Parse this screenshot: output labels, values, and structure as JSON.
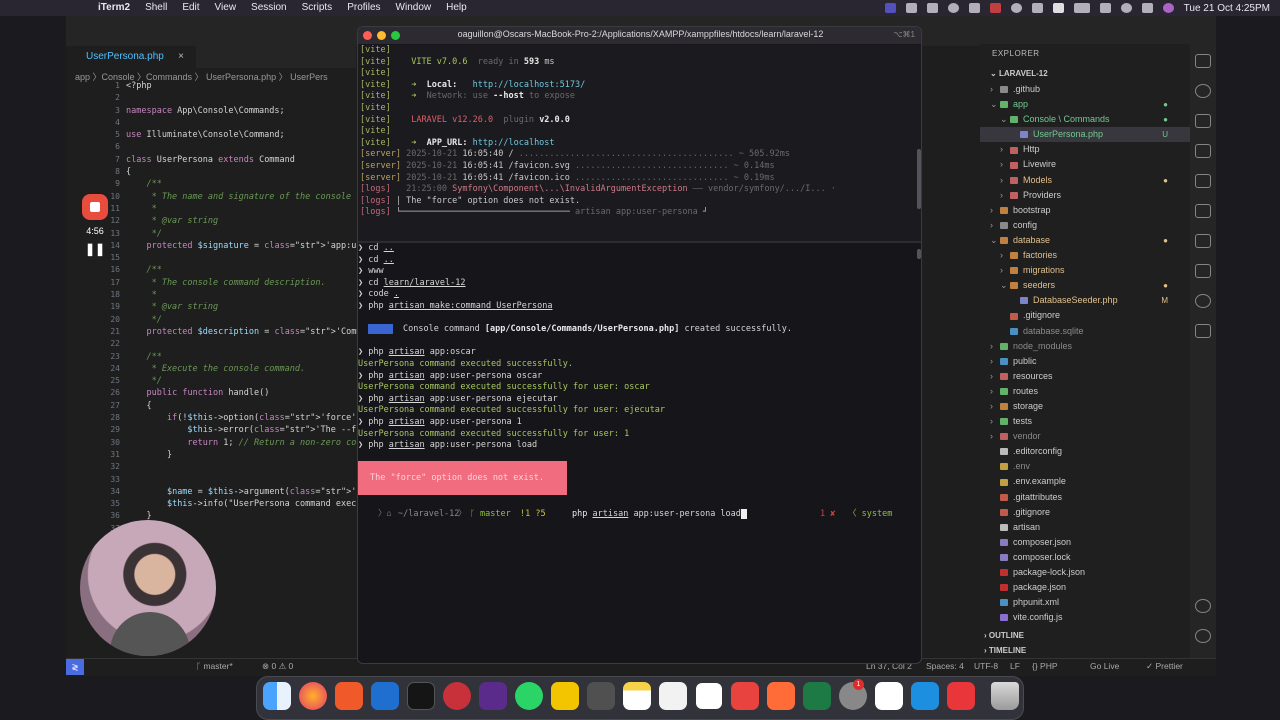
{
  "menubar": {
    "app_name": "iTerm2",
    "items": [
      "Shell",
      "Edit",
      "View",
      "Session",
      "Scripts",
      "Profiles",
      "Window",
      "Help"
    ],
    "date_time": "Tue 21 Oct  4:25PM"
  },
  "editor": {
    "tab_label": "UserPersona.php",
    "tab_close": "×",
    "breadcrumb": "app 〉Console 〉Commands 〉 UserPersona.php 〉 UserPers",
    "line_numbers": [
      "1",
      "2",
      "3",
      "4",
      "5",
      "6",
      "7",
      "8",
      "9",
      "10",
      "11",
      "12",
      "13",
      "14",
      "15",
      "16",
      "17",
      "18",
      "19",
      "20",
      "21",
      "22",
      "23",
      "24",
      "25",
      "26",
      "27",
      "28",
      "29",
      "30",
      "31",
      "32",
      "33",
      "34",
      "35",
      "36",
      "37"
    ],
    "code_lines": [
      "<?php",
      "",
      "namespace App\\Console\\Commands;",
      "",
      "use Illuminate\\Console\\Command;",
      "",
      "class UserPersona extends Command",
      "{",
      "    /**",
      "     * The name and signature of the console comm",
      "     *",
      "     * @var string",
      "     */",
      "    protected $signature = 'app:user-persona {name",
      "",
      "    /**",
      "     * The console command description.",
      "     *",
      "     * @var string",
      "     */",
      "    protected $description = 'Command description'",
      "",
      "    /**",
      "     * Execute the console command.",
      "     */",
      "    public function handle()",
      "    {",
      "        if(!$this->option('force')) {",
      "            $this->error('The --force option is re",
      "            return 1; // Return a non-zero code to",
      "        }",
      "",
      "",
      "        $name = $this->argument('name');",
      "        $this->info(\"UserPersona command executed",
      "    }",
      "}"
    ]
  },
  "recorder": {
    "time": "4:56",
    "pause_symbol": "❚❚"
  },
  "iterm": {
    "title": "oaguillon@Oscars-MacBook-Pro-2:/Applications/XAMPP/xamppfiles/htdocs/learn/laravel-12",
    "shortcut": "⌥⌘1",
    "vite": {
      "tag": "[vite]",
      "version": "VITE v7.0.6",
      "ready": "ready in",
      "ready_ms": "593",
      "ms": "ms",
      "local_label": "Local:",
      "local_url": "http://localhost:5173/",
      "network_label": "Network:",
      "network_text": "use",
      "network_flag": "--host",
      "network_tail": "to expose",
      "laravel_version": "LARAVEL v12.26.0",
      "plugin_label": "plugin",
      "plugin_version": "v2.0.0",
      "app_url_label": "APP_URL:",
      "app_url": "http://localhost"
    },
    "server_lines": [
      {
        "tag": "[server]",
        "date": "2025-10-21",
        "time": "16:05:40",
        "path": "/",
        "dots": "..........................................",
        "dur": "~ 505.92ms"
      },
      {
        "tag": "[server]",
        "date": "2025-10-21",
        "time": "16:05:41",
        "path": "/favicon.svg",
        "dots": "..............................",
        "dur": "~ 0.14ms"
      },
      {
        "tag": "[server]",
        "date": "2025-10-21",
        "time": "16:05:41",
        "path": "/favicon.ico",
        "dots": "..............................",
        "dur": "~ 0.19ms"
      }
    ],
    "logs": {
      "tag": "[logs]",
      "time": "21:25:00",
      "exception": "Symfony\\Component\\...\\InvalidArgumentException",
      "src": "—— vendor/symfony/.../I... ·",
      "message": "The \"force\" option does not exist.",
      "footer": "artisan app:user-persona"
    },
    "history": [
      {
        "sym": "❯",
        "cmd": "cd",
        "arg": ".."
      },
      {
        "sym": "❯",
        "cmd": "cd",
        "arg": ".."
      },
      {
        "sym": "❯",
        "cmd": "www",
        "arg": ""
      },
      {
        "sym": "❯",
        "cmd": "cd",
        "arg": "learn/laravel-12"
      },
      {
        "sym": "❯",
        "cmd": "code",
        "arg": "."
      },
      {
        "sym": "❯",
        "cmd": "php",
        "arg": "artisan make:command UserPersona"
      }
    ],
    "info_tag": "INFO",
    "info_text": "Console command",
    "info_path": "[app/Console/Commands/UserPersona.php]",
    "info_tail": "created successfully.",
    "runs": [
      {
        "cmd": "php",
        "rest": "app:oscar",
        "art": "artisan"
      },
      {
        "out": "UserPersona command executed successfully."
      },
      {
        "cmd": "php",
        "rest": "app:user-persona oscar",
        "art": "artisan"
      },
      {
        "out": "UserPersona command executed successfully for user: oscar"
      },
      {
        "cmd": "php",
        "rest": "app:user-persona ejecutar",
        "art": "artisan"
      },
      {
        "out": "UserPersona command executed successfully for user: ejecutar"
      },
      {
        "cmd": "php",
        "rest": "app:user-persona 1",
        "art": "artisan"
      },
      {
        "out": "UserPersona command executed successfully for user: 1"
      },
      {
        "cmd": "php",
        "rest": "app:user-persona load",
        "art": "artisan"
      }
    ],
    "error_box": "The \"force\" option does not exist.",
    "prompt": {
      "apple": "",
      "folder": "~/laravel-12",
      "branch_icon": "ᚴ",
      "branch": "master",
      "git_status": "!1 ?5",
      "command": "php",
      "artisan": "artisan",
      "args": "app:user-persona load",
      "exit": "1 ✘",
      "right": "〈 system"
    }
  },
  "explorer": {
    "title": "EXPLORER",
    "root": "LARAVEL-12",
    "items": [
      {
        "label": ".github",
        "depth": 1,
        "kind": "folder",
        "color": "#8a8a8a",
        "status": ""
      },
      {
        "label": "app",
        "depth": 1,
        "kind": "folder",
        "color": "#63b26a",
        "status": "●",
        "open": true,
        "text_color": "#73c991"
      },
      {
        "label": "Console \\ Commands",
        "depth": 2,
        "kind": "folder",
        "color": "#63b26a",
        "status": "●",
        "open": true,
        "text_color": "#73c991"
      },
      {
        "label": "UserPersona.php",
        "depth": 3,
        "kind": "php",
        "color": "#7a86c7",
        "status": "U",
        "text_color": "#73c991",
        "selected": true
      },
      {
        "label": "Http",
        "depth": 2,
        "kind": "folder",
        "color": "#c06060",
        "status": ""
      },
      {
        "label": "Livewire",
        "depth": 2,
        "kind": "folder",
        "color": "#c06060",
        "status": ""
      },
      {
        "label": "Models",
        "depth": 2,
        "kind": "folder",
        "color": "#c06060",
        "status": "●",
        "text_color": "#e2c08d"
      },
      {
        "label": "Providers",
        "depth": 2,
        "kind": "folder",
        "color": "#c06060",
        "status": ""
      },
      {
        "label": "bootstrap",
        "depth": 1,
        "kind": "folder",
        "color": "#c08040",
        "status": ""
      },
      {
        "label": "config",
        "depth": 1,
        "kind": "folder",
        "color": "#8a8a8a",
        "status": ""
      },
      {
        "label": "database",
        "depth": 1,
        "kind": "folder",
        "color": "#c08040",
        "status": "●",
        "open": true,
        "text_color": "#e2c08d"
      },
      {
        "label": "factories",
        "depth": 2,
        "kind": "folder",
        "color": "#c08040",
        "status": "",
        "text_color": "#e2c08d"
      },
      {
        "label": "migrations",
        "depth": 2,
        "kind": "folder",
        "color": "#c08040",
        "status": "",
        "text_color": "#e2c08d"
      },
      {
        "label": "seeders",
        "depth": 2,
        "kind": "folder",
        "color": "#c08040",
        "status": "●",
        "open": true,
        "text_color": "#e2c08d"
      },
      {
        "label": "DatabaseSeeder.php",
        "depth": 3,
        "kind": "php",
        "color": "#7a86c7",
        "status": "M",
        "text_color": "#e2c08d"
      },
      {
        "label": ".gitignore",
        "depth": 2,
        "kind": "file",
        "color": "#c05a4a",
        "status": ""
      },
      {
        "label": "database.sqlite",
        "depth": 2,
        "kind": "file",
        "color": "#4a90c0",
        "status": "",
        "text_color": "#8b8b8b"
      },
      {
        "label": "node_modules",
        "depth": 1,
        "kind": "folder",
        "color": "#63b26a",
        "status": "",
        "text_color": "#8b8b8b"
      },
      {
        "label": "public",
        "depth": 1,
        "kind": "folder",
        "color": "#4a90c0",
        "status": ""
      },
      {
        "label": "resources",
        "depth": 1,
        "kind": "folder",
        "color": "#c06060",
        "status": ""
      },
      {
        "label": "routes",
        "depth": 1,
        "kind": "folder",
        "color": "#63b26a",
        "status": ""
      },
      {
        "label": "storage",
        "depth": 1,
        "kind": "folder",
        "color": "#c08040",
        "status": ""
      },
      {
        "label": "tests",
        "depth": 1,
        "kind": "folder",
        "color": "#63b26a",
        "status": ""
      },
      {
        "label": "vendor",
        "depth": 1,
        "kind": "folder",
        "color": "#c06060",
        "status": "",
        "text_color": "#8b8b8b"
      },
      {
        "label": ".editorconfig",
        "depth": 1,
        "kind": "file",
        "color": "#bbbbbb",
        "status": ""
      },
      {
        "label": ".env",
        "depth": 1,
        "kind": "file",
        "color": "#c0a040",
        "status": "",
        "text_color": "#8b8b8b"
      },
      {
        "label": ".env.example",
        "depth": 1,
        "kind": "file",
        "color": "#c0a040",
        "status": ""
      },
      {
        "label": ".gitattributes",
        "depth": 1,
        "kind": "file",
        "color": "#c05a4a",
        "status": ""
      },
      {
        "label": ".gitignore",
        "depth": 1,
        "kind": "file",
        "color": "#c05a4a",
        "status": ""
      },
      {
        "label": "artisan",
        "depth": 1,
        "kind": "file",
        "color": "#bbbbbb",
        "status": ""
      },
      {
        "label": "composer.json",
        "depth": 1,
        "kind": "file",
        "color": "#8a7ac0",
        "status": ""
      },
      {
        "label": "composer.lock",
        "depth": 1,
        "kind": "file",
        "color": "#8a7ac0",
        "status": ""
      },
      {
        "label": "package-lock.json",
        "depth": 1,
        "kind": "file",
        "color": "#c03030",
        "status": ""
      },
      {
        "label": "package.json",
        "depth": 1,
        "kind": "file",
        "color": "#c03030",
        "status": ""
      },
      {
        "label": "phpunit.xml",
        "depth": 1,
        "kind": "file",
        "color": "#4a90c0",
        "status": ""
      },
      {
        "label": "vite.config.js",
        "depth": 1,
        "kind": "file",
        "color": "#8a70d0",
        "status": ""
      }
    ],
    "outline": "OUTLINE",
    "timeline": "TIMELINE"
  },
  "statusbar": {
    "remote": "≷",
    "branch": "ᚴ master*",
    "sync": "⊗ 0 ⚠ 0",
    "position": "Ln 37, Col 2",
    "spaces": "Spaces: 4",
    "encoding": "UTF-8",
    "eol": "LF",
    "language": "{} PHP",
    "golive": "Go Live",
    "prettier": "✓ Prettier"
  },
  "dock": {
    "mail_badge": "1",
    "apps": [
      "Finder",
      "Firefox",
      "Brave",
      "VS Code",
      "iTerm",
      "DBngin",
      "Postman",
      "WhatsApp",
      "Sequel",
      "Calculator",
      "Notes",
      "Mail",
      "Notion",
      "Craft",
      "Postman Orange",
      "Excel",
      "Settings",
      "Slack",
      "Docker",
      "Laravel Herd",
      "Trash"
    ]
  }
}
